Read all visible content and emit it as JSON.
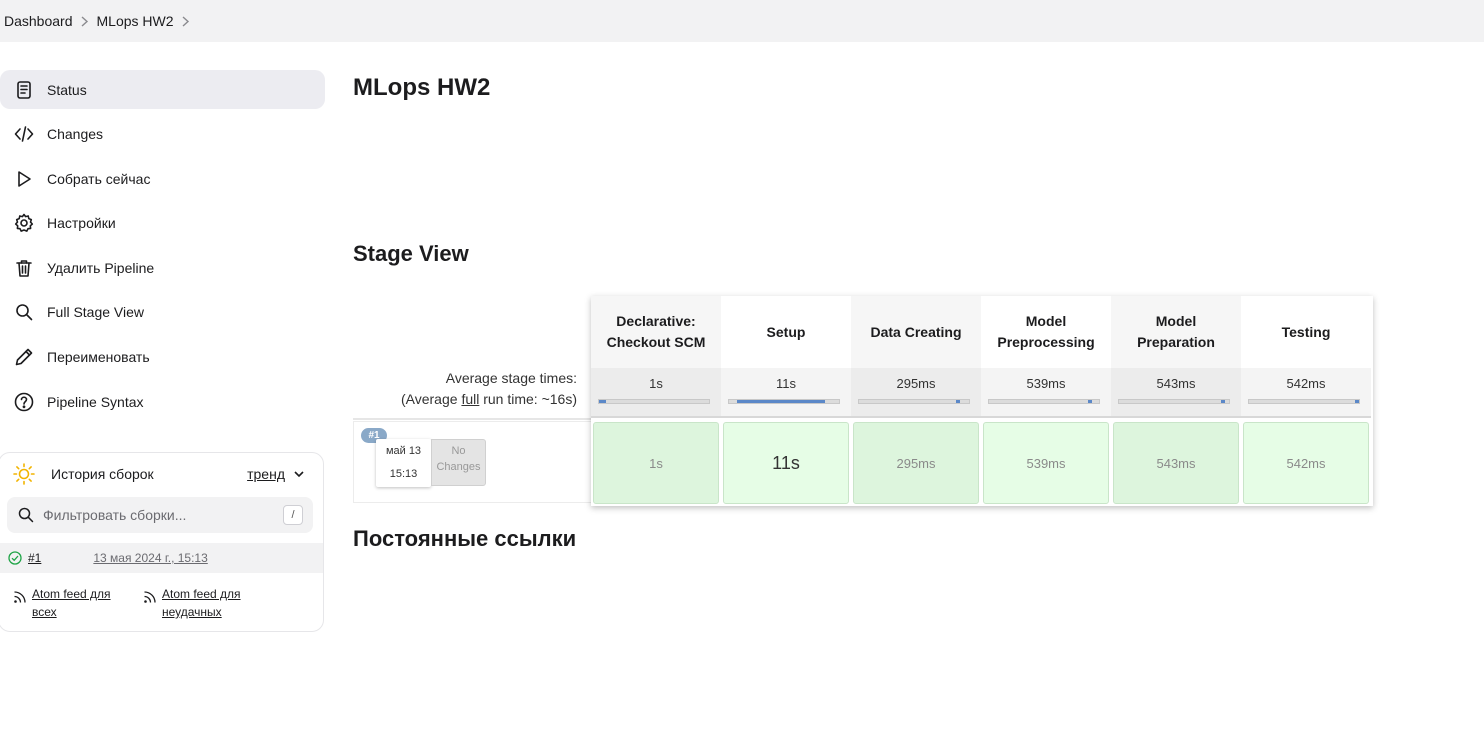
{
  "breadcrumb": [
    "Dashboard",
    "MLops HW2"
  ],
  "sidebar": {
    "items": [
      {
        "label": "Status",
        "icon": "document-icon"
      },
      {
        "label": "Changes",
        "icon": "code-icon"
      },
      {
        "label": "Собрать сейчас",
        "icon": "play-icon"
      },
      {
        "label": "Настройки",
        "icon": "gear-icon"
      },
      {
        "label": "Удалить Pipeline",
        "icon": "trash-icon"
      },
      {
        "label": "Full Stage View",
        "icon": "search-icon"
      },
      {
        "label": "Переименовать",
        "icon": "pencil-icon"
      },
      {
        "label": "Pipeline Syntax",
        "icon": "help-icon"
      }
    ]
  },
  "history": {
    "title": "История сборок",
    "trend": "тренд",
    "filter_placeholder": "Фильтровать сборки...",
    "shortcut": "/",
    "builds": [
      {
        "number": "#1",
        "date": "13 мая 2024 г., 15:13"
      }
    ],
    "feeds": [
      "Atom feed для всех",
      "Atom feed для неудачных"
    ]
  },
  "main": {
    "title": "MLops HW2",
    "stage_view_title": "Stage View",
    "permalinks_title": "Постоянные ссылки"
  },
  "stage_view": {
    "avg_label": "Average stage times:",
    "run_label_prefix": "(Average ",
    "run_label_link": "full",
    "run_label_suffix": " run time: ~16s)",
    "build": {
      "badge": "#1",
      "date": "май 13",
      "time": "15:13",
      "changes_line1": "No",
      "changes_line2": "Changes"
    },
    "stages": [
      {
        "name": "Declarative: Checkout SCM",
        "avg": "1s",
        "duration": "1s",
        "bar_start": 0.0,
        "bar_fraction": 0.06
      },
      {
        "name": "Setup",
        "avg": "11s",
        "duration": "11s",
        "bar_start": 0.07,
        "bar_fraction": 0.8
      },
      {
        "name": "Data Creating",
        "avg": "295ms",
        "duration": "295ms",
        "bar_start": 0.88,
        "bar_fraction": 0.02
      },
      {
        "name": "Model Preprocessing",
        "avg": "539ms",
        "duration": "539ms",
        "bar_start": 0.9,
        "bar_fraction": 0.03
      },
      {
        "name": "Model Preparation",
        "avg": "543ms",
        "duration": "543ms",
        "bar_start": 0.93,
        "bar_fraction": 0.03
      },
      {
        "name": "Testing",
        "avg": "542ms",
        "duration": "542ms",
        "bar_start": 0.96,
        "bar_fraction": 0.03
      }
    ],
    "colors": {
      "success_cell": "#e6fde6",
      "success_border": "#c9e5c9",
      "bar_fill": "#5b88c8"
    }
  }
}
